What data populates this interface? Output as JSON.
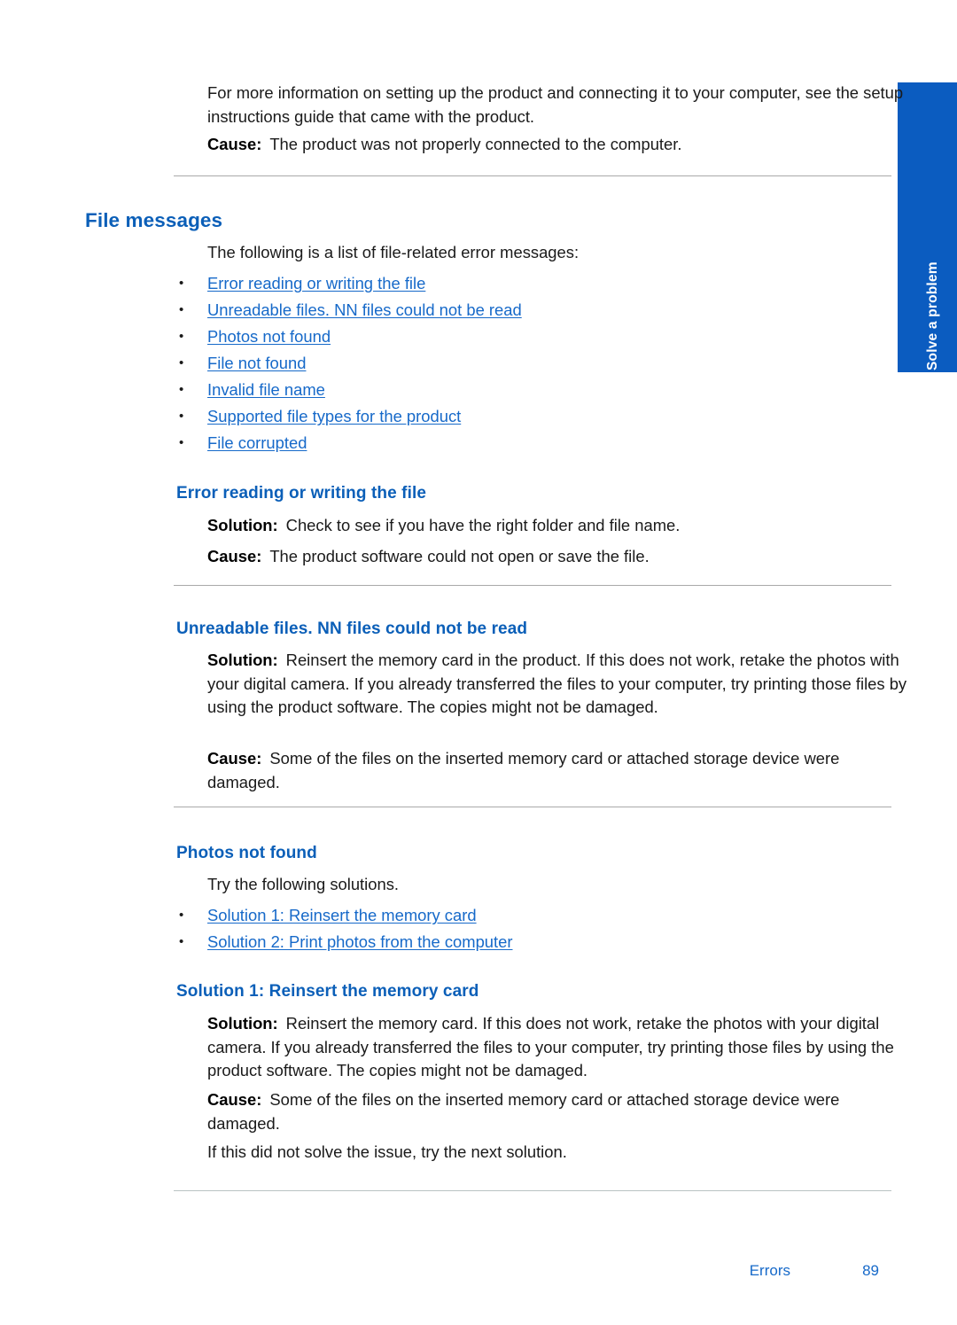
{
  "side_tab": {
    "label": "Solve a problem",
    "color": "#0b5cc0"
  },
  "intro": {
    "paragraph": "For more information on setting up the product and connecting it to your computer, see the setup instructions guide that came with the product.",
    "cause_label": "Cause:",
    "cause_text": "The product was not properly connected to the computer."
  },
  "section": {
    "title": "File messages",
    "intro": "The following is a list of file-related error messages:",
    "links": [
      "Error reading or writing the file",
      "Unreadable files. NN files could not be read",
      "Photos not found",
      "File not found",
      "Invalid file name",
      "Supported file types for the product",
      "File corrupted"
    ]
  },
  "sub1": {
    "title": "Error reading or writing the file",
    "solution_label": "Solution:",
    "solution_text": "Check to see if you have the right folder and file name.",
    "cause_label": "Cause:",
    "cause_text": "The product software could not open or save the file."
  },
  "sub2": {
    "title": "Unreadable files. NN files could not be read",
    "solution_label": "Solution:",
    "solution_text": "Reinsert the memory card in the product. If this does not work, retake the photos with your digital camera. If you already transferred the files to your computer, try printing those files by using the product software. The copies might not be damaged.",
    "cause_label": "Cause:",
    "cause_text": "Some of the files on the inserted memory card or attached storage device were damaged."
  },
  "sub3": {
    "title": "Photos not found",
    "intro": "Try the following solutions.",
    "links": [
      "Solution 1: Reinsert the memory card",
      "Solution 2: Print photos from the computer"
    ]
  },
  "sub4": {
    "title": "Solution 1: Reinsert the memory card",
    "solution_label": "Solution:",
    "solution_text": "Reinsert the memory card. If this does not work, retake the photos with your digital camera. If you already transferred the files to your computer, try printing those files by using the product software. The copies might not be damaged.",
    "cause_label": "Cause:",
    "cause_text": "Some of the files on the inserted memory card or attached storage device were damaged.",
    "next": "If this did not solve the issue, try the next solution."
  },
  "footer": {
    "label": "Errors",
    "page": "89"
  },
  "colors": {
    "heading_blue": "#0b5fb8",
    "link_blue": "#1669c9",
    "tab_blue": "#0b5cc0",
    "rule_gray": "#a9a9a9"
  }
}
